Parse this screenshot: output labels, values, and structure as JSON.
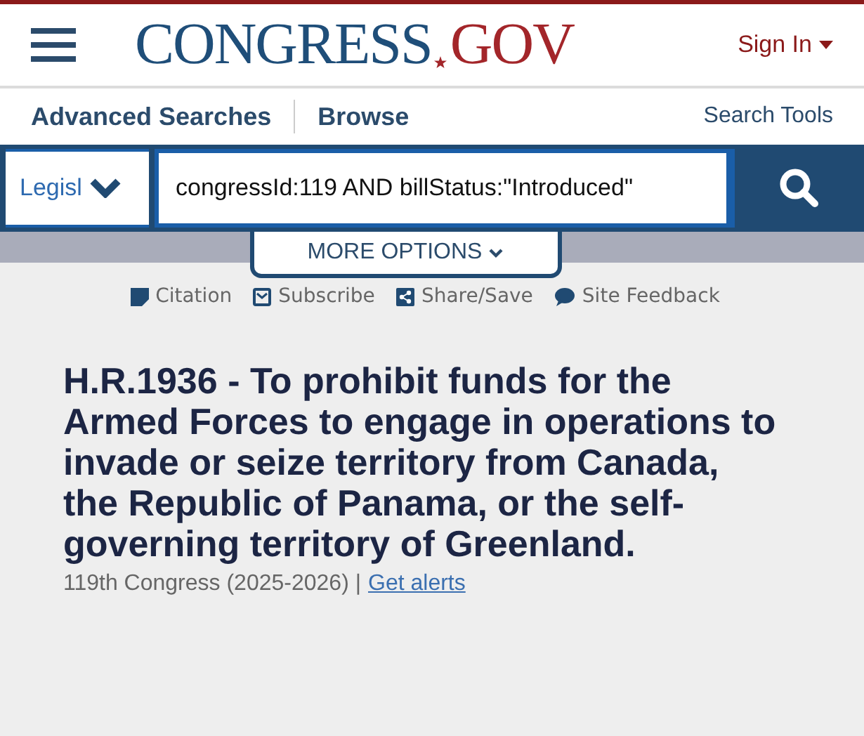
{
  "header": {
    "logo": {
      "name": "CONGRESS",
      "domain": "GOV"
    },
    "sign_in": "Sign In"
  },
  "nav": {
    "links": [
      "Advanced Searches",
      "Browse"
    ],
    "search_tools": "Search Tools"
  },
  "search": {
    "scope": "Legisl",
    "value": "congressId:119 AND billStatus:\"Introduced\"",
    "more_options": "MORE OPTIONS"
  },
  "actions": [
    {
      "kind": "citation",
      "label": "Citation"
    },
    {
      "kind": "subscribe",
      "label": "Subscribe"
    },
    {
      "kind": "share",
      "label": "Share/Save"
    },
    {
      "kind": "feedback",
      "label": "Site Feedback"
    }
  ],
  "bill": {
    "title": "H.R.1936 - To prohibit funds for the Armed Forces to engage in operations to invade or seize territory from Canada, the Republic of Panama, or the self-governing territory of Greenland.",
    "congress": "119th Congress (2025-2026) |",
    "alerts_link": "Get alerts"
  }
}
